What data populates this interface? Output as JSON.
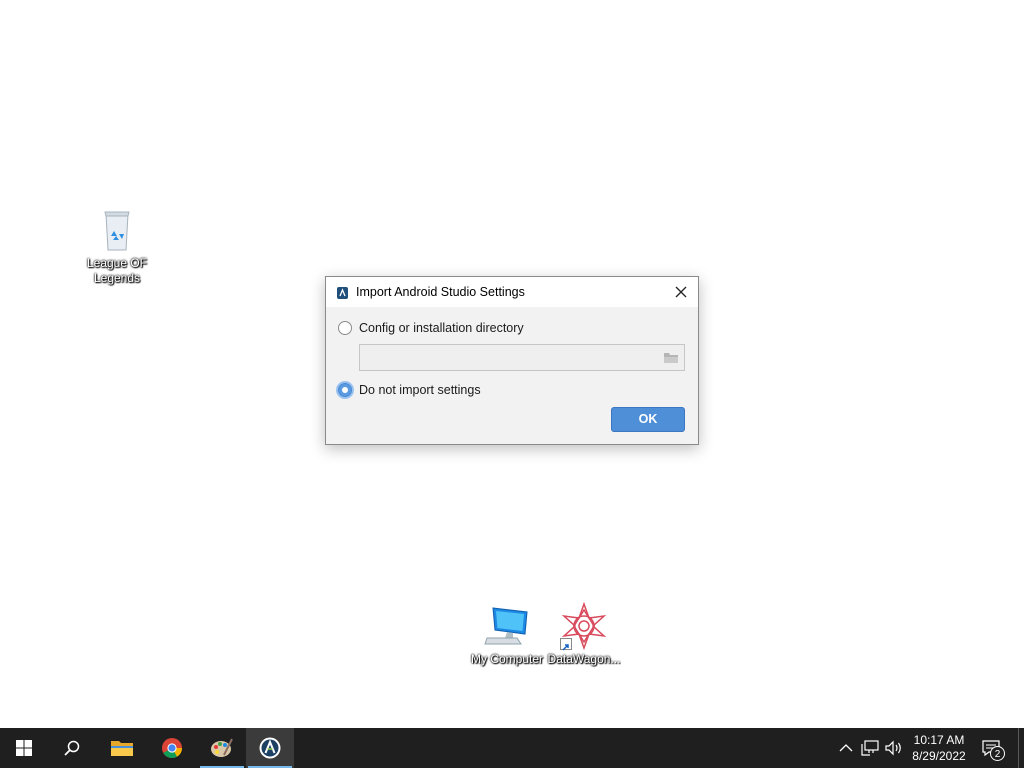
{
  "desktop": {
    "icons": [
      {
        "label": "League OF Legends",
        "icon": "recycle-bin-icon"
      },
      {
        "label": "My Computer",
        "icon": "computer-icon"
      },
      {
        "label": "DataWagon...",
        "icon": "datawagon-app-icon"
      }
    ]
  },
  "dialog": {
    "title": "Import Android Studio Settings",
    "options": [
      {
        "label": "Config or installation directory",
        "selected": false
      },
      {
        "label": "Do not import settings",
        "selected": true
      }
    ],
    "path_value": "",
    "ok_label": "OK"
  },
  "taskbar": {
    "apps": [
      {
        "name": "start",
        "icon": "windows-logo-icon"
      },
      {
        "name": "search",
        "icon": "search-icon"
      },
      {
        "name": "file-explorer",
        "icon": "folder-icon"
      },
      {
        "name": "chrome",
        "icon": "chrome-icon"
      },
      {
        "name": "paint",
        "icon": "paint-palette-icon"
      },
      {
        "name": "android-studio",
        "icon": "android-studio-icon"
      }
    ],
    "time": "10:17 AM",
    "date": "8/29/2022",
    "notification_count": "2"
  },
  "colors": {
    "accent": "#4f8fd8",
    "taskbar": "#1f1f1f",
    "taskbar_underline": "#76b9ed"
  }
}
